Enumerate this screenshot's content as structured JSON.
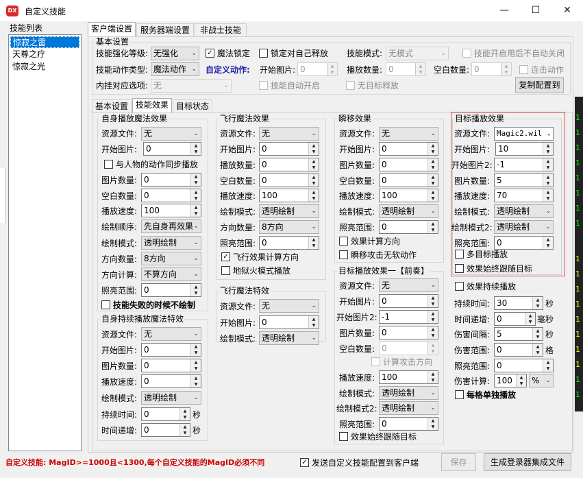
{
  "window": {
    "title": "自定义技能",
    "icon_text": "DX",
    "min": "—",
    "max": "☐",
    "close": "✕"
  },
  "skill_list": {
    "title": "技能列表",
    "items": [
      "惊寂之雷",
      "天尊之疗",
      "惊寂之光"
    ],
    "selected": 0
  },
  "main_tabs": [
    "客户端设置",
    "服务器端设置",
    "非战士技能"
  ],
  "basic": {
    "title": "基本设置",
    "strengthen_label": "技能强化等级:",
    "strengthen_value": "无强化",
    "magic_lock": "魔法锁定",
    "lock_self": "锁定对自己释放",
    "skill_mode_label": "技能模式:",
    "skill_mode_value": "无模式",
    "no_auto_close": "技能开启用后不自动关闭",
    "action_type_label": "技能动作类型:",
    "action_type_value": "魔法动作",
    "custom_action": "自定义动作:",
    "start_img_label": "开始图片:",
    "start_img_value": "0",
    "play_count_label": "播放数量:",
    "play_count_value": "0",
    "blank_count_label": "空白数量:",
    "blank_count_value": "0",
    "combo_action": "连击动作",
    "inner_hook_label": "内挂对应选项:",
    "inner_hook_value": "无",
    "auto_open": "技能自动开启",
    "no_target": "无目标释放",
    "copy_btn": "复制配置到"
  },
  "sub_tabs": [
    "基本设置",
    "技能效果",
    "目标状态"
  ],
  "self_effect": {
    "title": "自身播放魔法效果",
    "res_label": "资源文件:",
    "res_value": "无",
    "start_label": "开始图片:",
    "start_value": "0",
    "sync": "与人物的动作同步播放",
    "img_count_label": "图片数量:",
    "img_count_value": "0",
    "blank_label": "空白数量:",
    "blank_value": "0",
    "speed_label": "播放速度:",
    "speed_value": "100",
    "order_label": "绘制顺序:",
    "order_value": "先自身再效果",
    "mode_label": "绘制模式:",
    "mode_value": "透明绘制",
    "dir_count_label": "方向数量:",
    "dir_count_value": "8方向",
    "dir_calc_label": "方向计算:",
    "dir_calc_value": "不算方向",
    "light_label": "照亮范围:",
    "light_value": "0",
    "fail_no_draw": "技能失败的时候不绘制"
  },
  "self_persist": {
    "title": "自身持续播放魔法特效",
    "res_label": "资源文件:",
    "res_value": "无",
    "start_label": "开始图片:",
    "start_value": "0",
    "img_count_label": "图片数量:",
    "img_count_value": "0",
    "speed_label": "播放速度:",
    "speed_value": "0",
    "mode_label": "绘制模式:",
    "mode_value": "透明绘制",
    "dur_label": "持续时间:",
    "dur_value": "0",
    "dur_unit": "秒",
    "inc_label": "时间递增:",
    "inc_value": "0",
    "inc_unit": "秒"
  },
  "fly_effect": {
    "title": "飞行魔法效果",
    "res_label": "资源文件:",
    "res_value": "无",
    "start_label": "开始图片:",
    "start_value": "0",
    "play_label": "播放数量:",
    "play_value": "0",
    "blank_label": "空白数量:",
    "blank_value": "0",
    "speed_label": "播放速度:",
    "speed_value": "100",
    "mode_label": "绘制模式:",
    "mode_value": "透明绘制",
    "dir_label": "方向数量:",
    "dir_value": "8方向",
    "light_label": "照亮范围:",
    "light_value": "0",
    "calc_dir": "飞行效果计算方向",
    "hell_fire": "地狱火模式播放"
  },
  "fly_special": {
    "title": "飞行魔法特效",
    "res_label": "资源文件:",
    "res_value": "无",
    "start_label": "开始图片:",
    "start_value": "0",
    "mode_label": "绘制模式:",
    "mode_value": "透明绘制"
  },
  "teleport": {
    "title": "瞬移效果",
    "res_label": "资源文件:",
    "res_value": "无",
    "start_label": "开始图片:",
    "start_value": "0",
    "img_label": "图片数量:",
    "img_value": "0",
    "blank_label": "空白数量:",
    "blank_value": "0",
    "speed_label": "播放速度:",
    "speed_value": "100",
    "mode_label": "绘制模式:",
    "mode_value": "透明绘制",
    "light_label": "照亮范围:",
    "light_value": "0",
    "calc_dir": "效果计算方向",
    "no_soft": "瞬移攻击无软动作"
  },
  "target_pre": {
    "title": "目标播放效果一【前奏】",
    "res_label": "资源文件:",
    "res_value": "无",
    "start_label": "开始图片:",
    "start_value": "0",
    "start2_label": "开始图片2:",
    "start2_value": "-1",
    "img_label": "图片数量:",
    "img_value": "0",
    "blank_label": "空白数量:",
    "blank_value": "0",
    "calc_attack_dir": "计算攻击方向",
    "speed_label": "播放速度:",
    "speed_value": "100",
    "mode_label": "绘制模式:",
    "mode_value": "透明绘制",
    "mode2_label": "绘制模式2:",
    "mode2_value": "透明绘制",
    "light_label": "照亮范围:",
    "light_value": "0",
    "follow": "效果始终跟随目标"
  },
  "target_effect": {
    "title": "目标播放效果",
    "res_label": "资源文件:",
    "res_value": "Magic2.wil",
    "start_label": "开始图片:",
    "start_value": "10",
    "start2_label": "开始图片2:",
    "start2_value": "-1",
    "img_label": "图片数量:",
    "img_value": "5",
    "speed_label": "播放速度:",
    "speed_value": "70",
    "mode_label": "绘制模式:",
    "mode_value": "透明绘制",
    "mode2_label": "绘制模式2:",
    "mode2_value": "透明绘制",
    "light_label": "照亮范围:",
    "light_value": "0",
    "multi": "多目标播放",
    "follow": "效果始终跟随目标"
  },
  "persist": {
    "continue": "效果持续播放",
    "dur_label": "持续时间:",
    "dur_value": "30",
    "dur_unit": "秒",
    "inc_label": "时间递增:",
    "inc_value": "0",
    "inc_unit": "毫秒",
    "interval_label": "伤害间隔:",
    "interval_value": "5",
    "interval_unit": "秒",
    "range_label": "伤害范围:",
    "range_value": "0",
    "range_unit": "格",
    "light_label": "照亮范围:",
    "light_value": "0",
    "calc_label": "伤害计算:",
    "calc_value": "100",
    "calc_unit": "%",
    "per_cell": "每格单独播放"
  },
  "footer": {
    "note": "自定义技能: MagID>=1000且<1300,每个自定义技能的MagID必须不同",
    "send": "发送自定义技能配置到客户端",
    "save": "保存",
    "gen": "生成登录器集成文件"
  },
  "colors": {
    "accent": "#0078d7",
    "note": "#cc0000",
    "highlight_border": "#e05050",
    "custom_action": "#1a1aa6"
  }
}
